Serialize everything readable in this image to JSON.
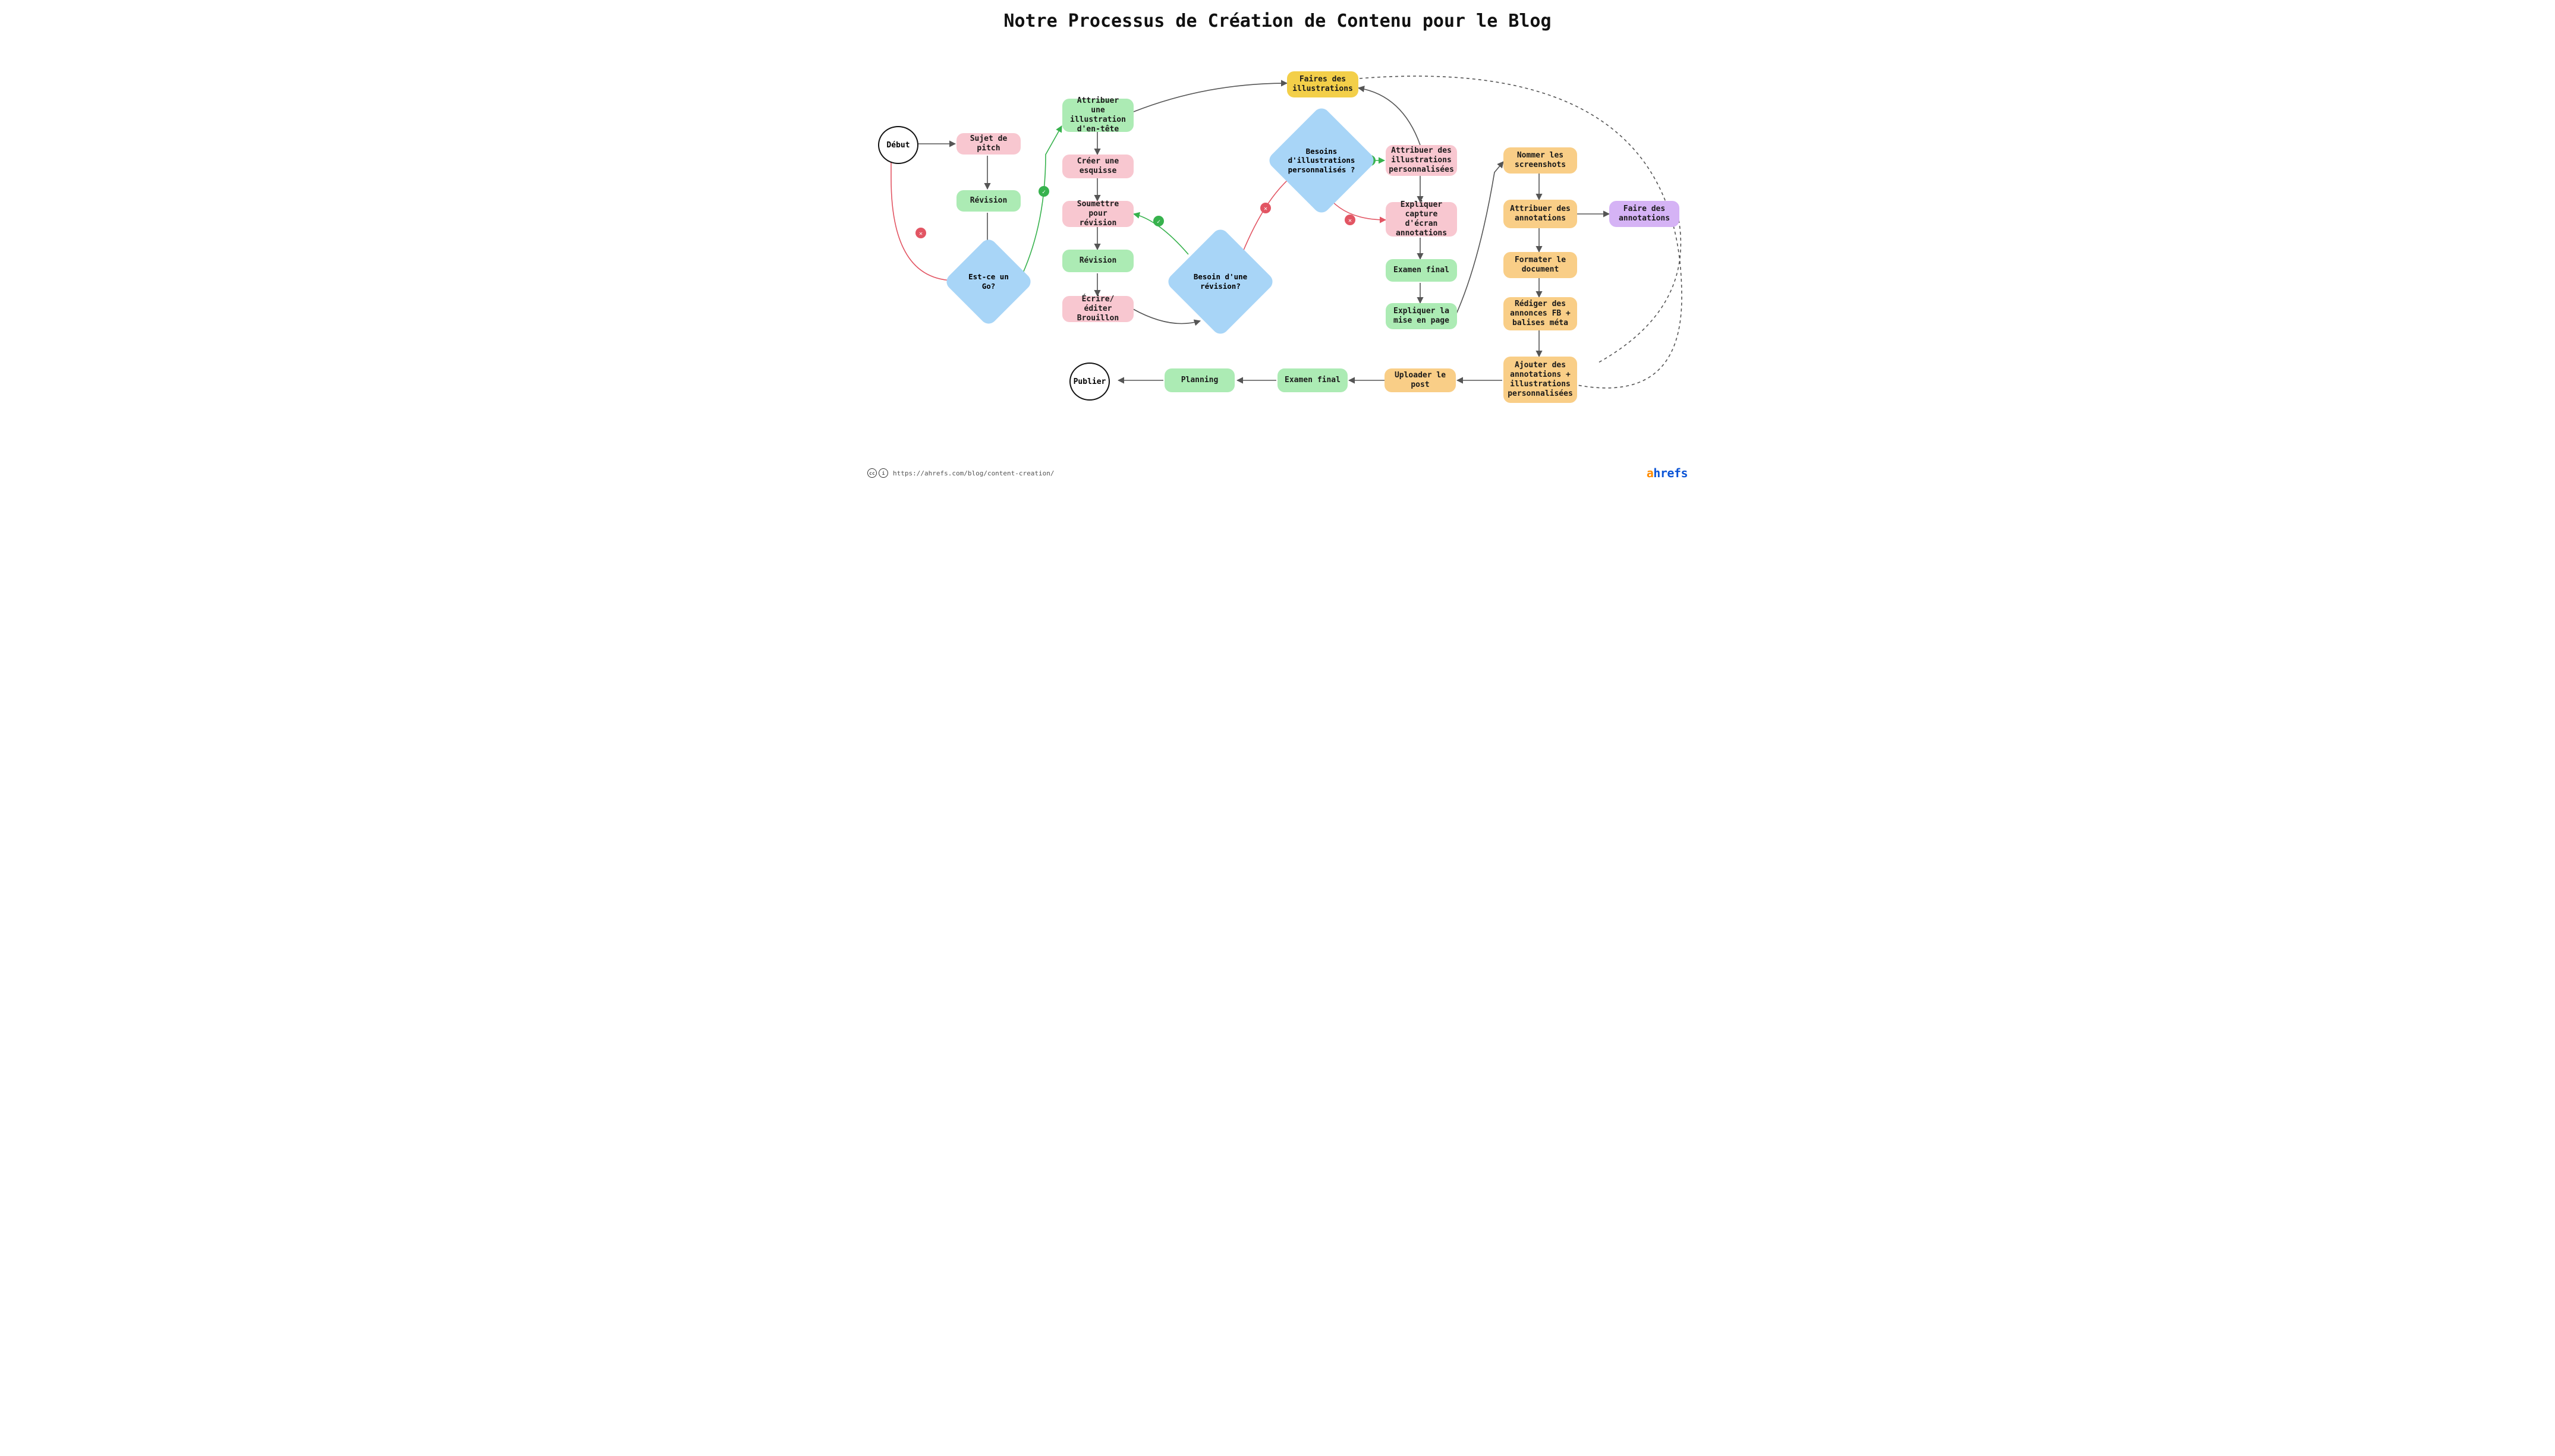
{
  "title": "Notre Processus de  Création de Contenu pour le Blog",
  "nodes": {
    "start": "Début",
    "pitch": "Sujet de pitch",
    "review1": "Révision",
    "go": "Est-ce un Go?",
    "assign_header": "Attribuer   une illustration d'en-tête",
    "sketch": "Créer une esquisse",
    "submit_review": "Soumettre pour révision",
    "review2": "Révision",
    "write_draft": "Écrire/éditer Brouillon",
    "need_revision": "Besoin d'une révision?",
    "need_custom": "Besoins d'illustrations personnalisés ?",
    "make_illustrations": "Faires des illustrations",
    "assign_custom": "Attribuer des illustrations personnalisées",
    "explain_screenshot": "Expliquer capture d'écran annotations",
    "final_exam1": "Examen final",
    "explain_layout": "Expliquer la mise en page",
    "name_screenshots": "Nommer les screenshots",
    "assign_annotations": "Attribuer des annotations",
    "make_annotations": "Faire des annotations",
    "format_doc": "Formater le document",
    "write_fb": "Rédiger des annonces FB + balises méta",
    "add_annotations": "Ajouter des annotations + illustrations personnalisées",
    "upload": "Uploader le post",
    "final_exam2": "Examen final",
    "planning": "Planning",
    "publish": "Publier"
  },
  "footer": {
    "url": "https://ahrefs.com/blog/content-creation/",
    "brand_a": "a",
    "brand_rest": "hrefs"
  },
  "marks": {
    "yes": "✓",
    "no": "✕"
  }
}
